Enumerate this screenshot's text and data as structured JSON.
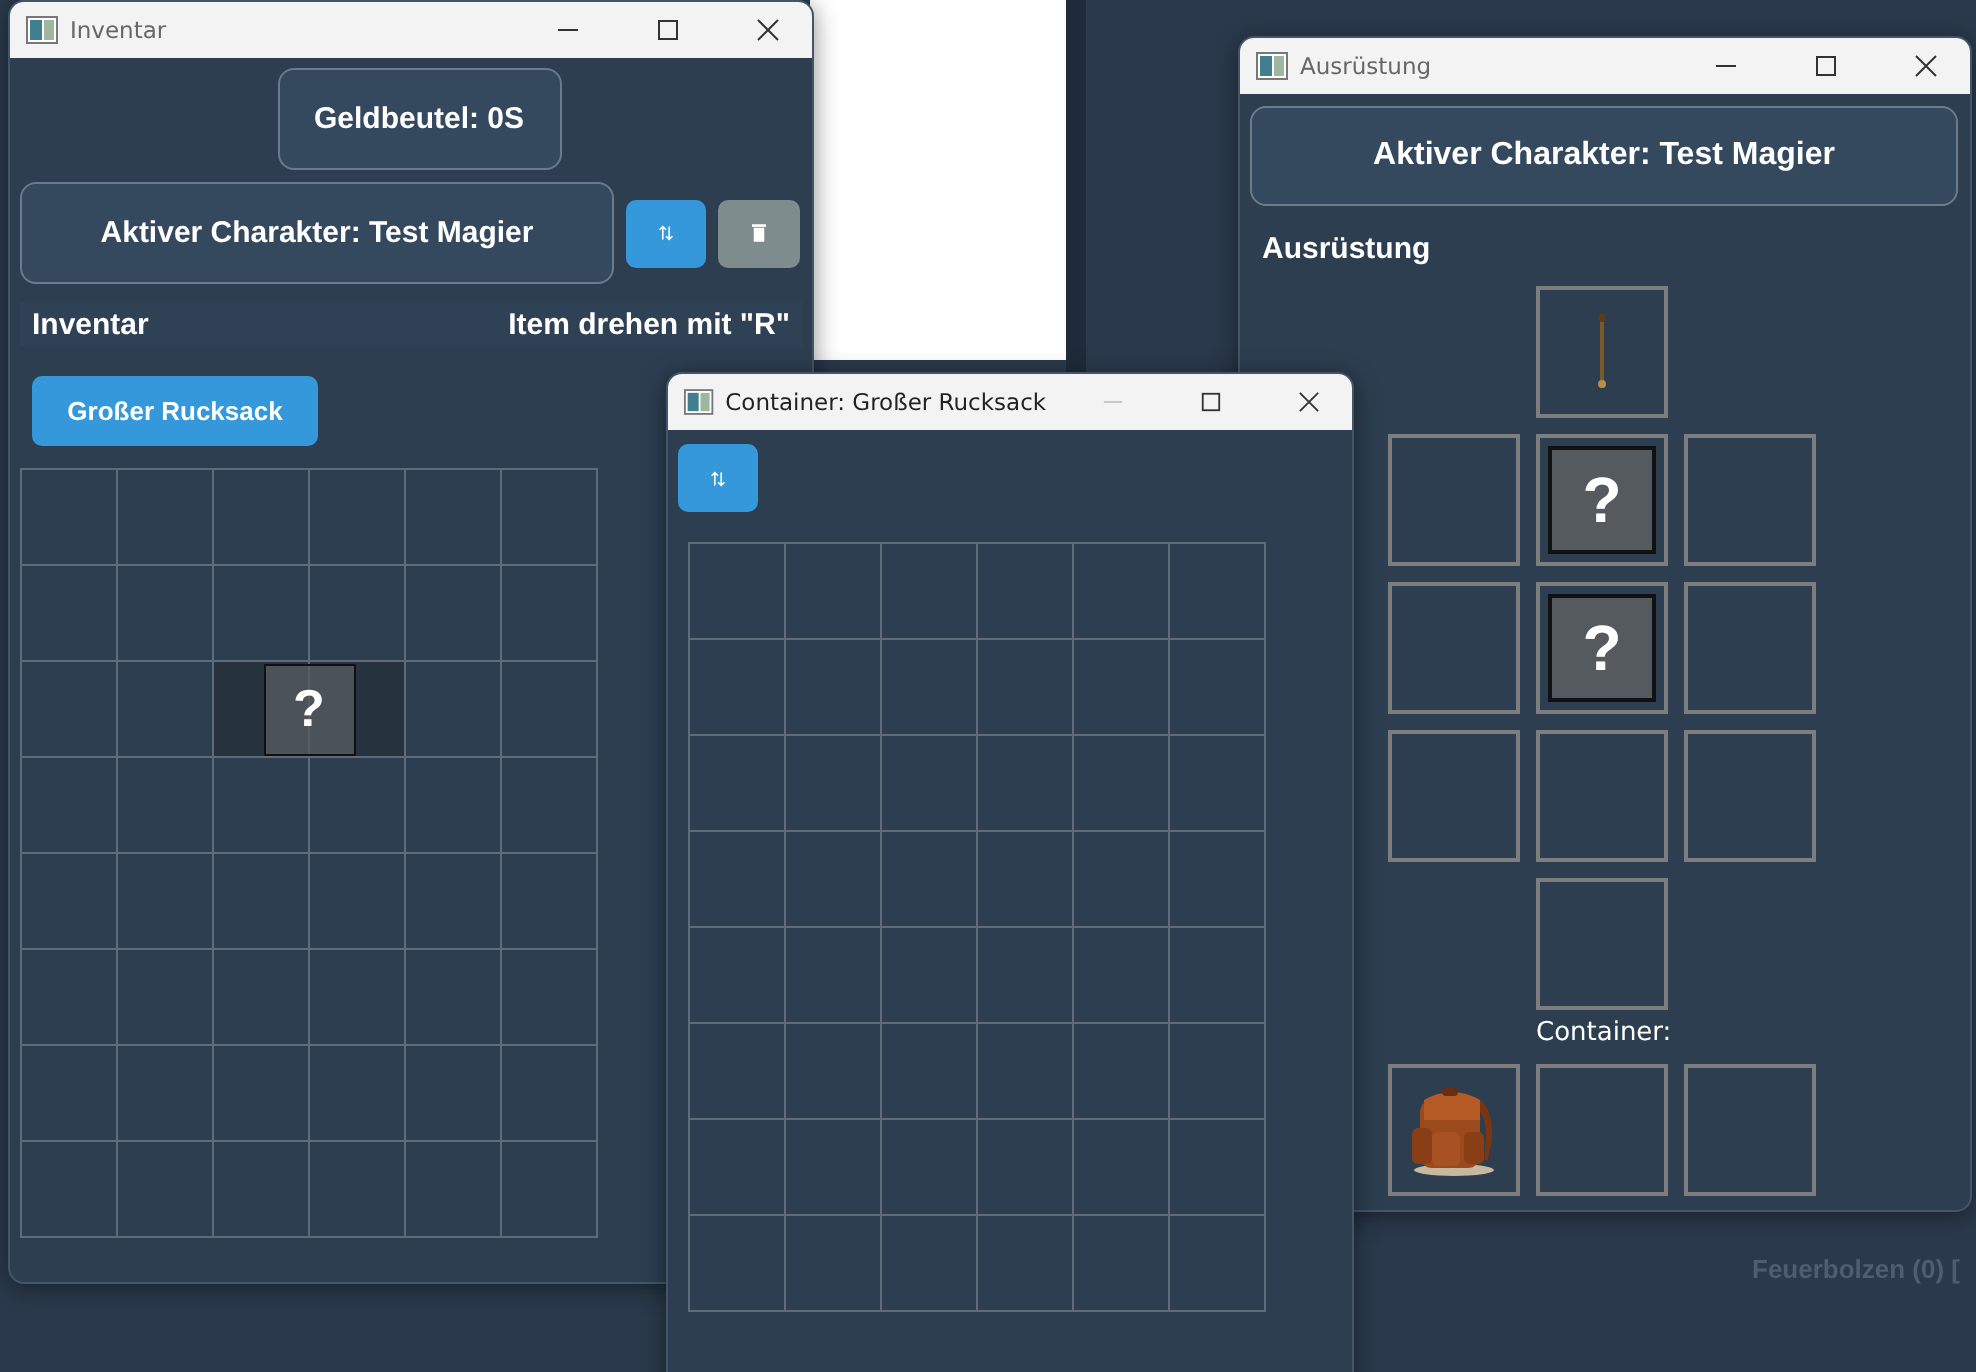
{
  "background_app": {
    "text": "Feuerbolzen (0) ["
  },
  "inventory_window": {
    "title": "Inventar",
    "minimize_disabled": false,
    "purse": "Geldbeutel: 0S",
    "active_character": "Aktiver Charakter: Test Magier",
    "section_label": "Inventar",
    "hint": "Item drehen mit \"R\"",
    "container_button": "Großer Rucksack",
    "items": [
      {
        "kind": "unknown",
        "label": "?"
      }
    ]
  },
  "container_window": {
    "title": "Container: Großer Rucksack",
    "minimize_disabled": true
  },
  "equipment_window": {
    "title": "Ausrüstung",
    "minimize_disabled": false,
    "active_character": "Aktiver Charakter: Test Magier",
    "section_label": "Ausrüstung",
    "slots": [
      {
        "kind": "staff"
      },
      {
        "kind": "empty"
      },
      {
        "kind": "unknown",
        "label": "?"
      },
      {
        "kind": "empty"
      },
      {
        "kind": "empty"
      },
      {
        "kind": "unknown",
        "label": "?"
      },
      {
        "kind": "empty"
      },
      {
        "kind": "empty"
      },
      {
        "kind": "empty"
      },
      {
        "kind": "empty"
      },
      {
        "kind": "empty"
      }
    ],
    "container_label": "Container:",
    "container_slots": [
      {
        "kind": "backpack"
      },
      {
        "kind": "empty"
      },
      {
        "kind": "empty"
      }
    ]
  }
}
